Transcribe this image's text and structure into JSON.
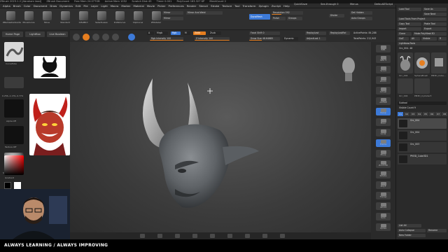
{
  "title_bar": {
    "app": "ZBrush 2023.1.2 [Abraham lead]",
    "document": "ZBrush Document",
    "free_mem": "Free Mem 24.077GB",
    "active_mem": "Active Mem 1052",
    "scratch_disk": "Scratch Disk 45",
    "timer": "Timer 0.001",
    "poly_count": "PolyCount 163.327 KP",
    "mesh_count": "MeshCount 2"
  },
  "menu": [
    "Alpha",
    "Brush",
    "Color",
    "Document",
    "Draw",
    "Dynamics",
    "Edit",
    "File",
    "Layer",
    "Light",
    "Macro",
    "Marker",
    "Material",
    "Movie",
    "Picker",
    "Preferences",
    "Render",
    "Stencil",
    "Stroke",
    "Texture",
    "Tool",
    "Transform",
    "Zplugin",
    "Zscript",
    "Help"
  ],
  "quick_access": {
    "quicksave": "QuickSave",
    "see_through": "See-through 0",
    "menus": "Menus",
    "default_zscript": "DefaultZScript"
  },
  "shelf": {
    "tools": [
      "ZRemesherGuide",
      "MoveCurve",
      "Move",
      "Standard",
      "InflatBrd",
      "SelectLasso",
      "KnifeCurve",
      "ClipCurve",
      "ZModeler"
    ],
    "mirror": "Mirror",
    "mirror_weld": "Mirror And Weld",
    "mirror2": "Mirror",
    "dynamesh": "DynaMesh",
    "resolution": "Resolution 592",
    "polish": "Polish",
    "groups": "Groups",
    "divide": "Divide",
    "del_hidden": "Del Hidden",
    "auto_groups": "Auto Groups"
  },
  "draw_bar": {
    "modes": [
      "Edit",
      "Draw",
      "Move",
      "Scale",
      "Rotate"
    ],
    "a_label": "A",
    "mrgb": "Mrgb",
    "rgb": "Rgb",
    "m": "M",
    "zadd": "Zadd",
    "zsub": "Zsub",
    "rgb_intensity": "Rgb Intensity 100",
    "z_intensity": "Z Intensity 100",
    "focal_shift": "Focal Shift 0",
    "draw_size": "Draw Size 48.64685",
    "dynamic": "Dynamic",
    "replay_last": "ReplayLast",
    "replay_last_rel": "ReplayLastRel",
    "adjust_last": "AdjustLast 1",
    "active_points": "ActivePoints: 84,288",
    "total_points": "TotalPoints: 212,943"
  },
  "left_panel": {
    "home_page": "Home Page",
    "lightbox": "LightBox",
    "live_boolean": "Live Boolean",
    "brush_name": "CurveTube",
    "coords": "0.256,-1.179,-0.774",
    "alpha_label": "Alpha Off",
    "texture_label": "Texture Off",
    "material_label": "StartupMaterial",
    "gradient_label": "Gradient",
    "switch_color": "SwitchColor",
    "alternate": "Alternate"
  },
  "right_panel": {
    "load_tool": "Load Tool",
    "save_as": "Save As",
    "save_next": "Save Next",
    "load_tools_from_project": "Load Tools From Project",
    "copy_tool": "Copy Tool",
    "paste_tool": "Paste Tool",
    "import": "Import",
    "export": "Export",
    "clone": "Clone",
    "make_polymesh": "Make PolyMesh3D",
    "goz": "GoZ",
    "all": "All",
    "visible": "Visible",
    "r": "R",
    "lightbox_tools": "Lightbox▸Tools",
    "current_tool": "Orc_004. 48",
    "thumbs": [
      "Orc_004",
      "SphereBrush",
      "PM3D_Cube...",
      "Orc_004",
      "PM3D_Cylinder3"
    ],
    "subtool_header": "Subtool",
    "visible_count": "Visible Count 9",
    "v_tabs": [
      "V1",
      "V2",
      "V3",
      "V4",
      "V5",
      "V6",
      "V7",
      "V8"
    ],
    "subtools": [
      "Orc_004",
      "Orc_004",
      "Orc_003",
      "PM3D_Cube3D1"
    ],
    "list_all": "List All",
    "auto_collapse": "Auto Collapse",
    "rename": "Rename",
    "new_folder": "New Folder"
  },
  "nav": [
    "BPR",
    "SPix 3",
    "Scroll",
    "Zoom",
    "Actual",
    "AAHalf",
    "Persp",
    "Floor",
    "Local",
    "Frame",
    "Move",
    "Zoom3D",
    "Rotate",
    "PolyF",
    "Transp",
    "Ghost",
    "Solo",
    "Xpose"
  ],
  "banner": "ALWAYS LEARNING  /  ALWAYS IMPROVING",
  "colors": {
    "accent_orange": "#e67e1f",
    "accent_blue": "#3d7ad8",
    "model_gray": "#6e7276"
  }
}
